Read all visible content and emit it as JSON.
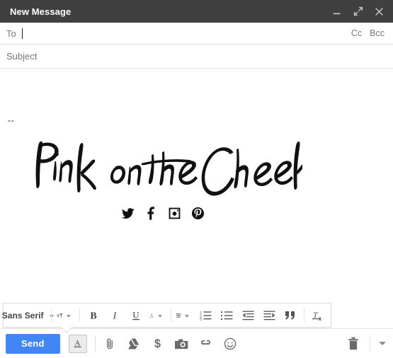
{
  "window": {
    "title": "New Message",
    "controls": [
      {
        "name": "minimize-icon",
        "label": "Minimize"
      },
      {
        "name": "expand-icon",
        "label": "Full screen"
      },
      {
        "name": "close-icon",
        "label": "Save & close"
      }
    ]
  },
  "fields": {
    "to_label": "To",
    "to_value": "",
    "cc_label": "Cc",
    "bcc_label": "Bcc",
    "subject_placeholder": "Subject",
    "subject_value": ""
  },
  "body": {
    "signature_separator": "--",
    "signature_wordmark": "Pink on the Cheek",
    "social_icons": [
      {
        "name": "twitter-icon",
        "label": "Twitter"
      },
      {
        "name": "facebook-icon",
        "label": "Facebook"
      },
      {
        "name": "instagram-icon",
        "label": "Instagram"
      },
      {
        "name": "pinterest-icon",
        "label": "Pinterest"
      }
    ]
  },
  "format_toolbar": {
    "font_name": "Sans Serif",
    "items": [
      {
        "name": "font-family-dropdown",
        "label": "Sans Serif"
      },
      {
        "name": "font-size-button",
        "label": "Size"
      },
      {
        "name": "bold-button",
        "label": "B"
      },
      {
        "name": "italic-button",
        "label": "I"
      },
      {
        "name": "underline-button",
        "label": "U"
      },
      {
        "name": "text-color-button",
        "label": "A"
      },
      {
        "name": "align-button",
        "label": "Align"
      },
      {
        "name": "numbered-list-button",
        "label": "Numbered list"
      },
      {
        "name": "bulleted-list-button",
        "label": "Bulleted list"
      },
      {
        "name": "indent-less-button",
        "label": "Indent less"
      },
      {
        "name": "indent-more-button",
        "label": "Indent more"
      },
      {
        "name": "quote-button",
        "label": "Quote"
      },
      {
        "name": "remove-formatting-button",
        "label": "Remove formatting"
      }
    ]
  },
  "action_bar": {
    "send_label": "Send",
    "format_toggle_label": "A",
    "icons": [
      {
        "name": "attach-file-icon",
        "label": "Attach files"
      },
      {
        "name": "google-drive-icon",
        "label": "Insert files using Drive"
      },
      {
        "name": "insert-money-icon",
        "label": "Insert money"
      },
      {
        "name": "insert-photo-icon",
        "label": "Insert photo"
      },
      {
        "name": "insert-link-icon",
        "label": "Insert link"
      },
      {
        "name": "insert-emoji-icon",
        "label": "Insert emoji"
      }
    ],
    "discard_label": "Discard draft",
    "more_options_label": "More options"
  },
  "colors": {
    "header_bg": "#404040",
    "send_blue": "#4285f4",
    "icon_gray": "#6b6b6b",
    "border": "#e0e0e0"
  }
}
